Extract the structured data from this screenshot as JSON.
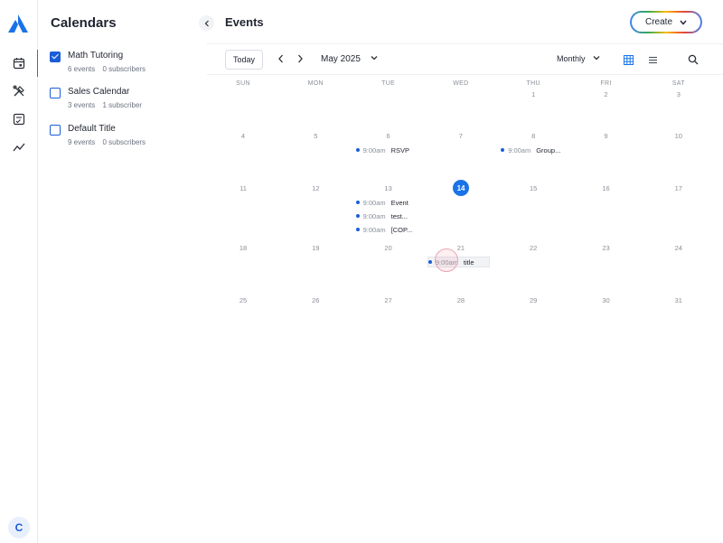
{
  "rail": {
    "nav_icons": [
      "calendar-icon",
      "tools-icon",
      "checklist-icon",
      "analytics-icon"
    ],
    "avatar_initial": "C"
  },
  "sidebar": {
    "title": "Calendars",
    "calendars": [
      {
        "name": "Math Tutoring",
        "events": "6 events",
        "subscribers": "0 subscribers",
        "checked": true
      },
      {
        "name": "Sales Calendar",
        "events": "3 events",
        "subscribers": "1 subscriber",
        "checked": false
      },
      {
        "name": "Default Title",
        "events": "9 events",
        "subscribers": "0 subscribers",
        "checked": false
      }
    ]
  },
  "header": {
    "title": "Events",
    "create_label": "Create"
  },
  "toolbar": {
    "today_label": "Today",
    "month_label": "May 2025",
    "view_label": "Monthly"
  },
  "calendar": {
    "weekdays": [
      "SUN",
      "MON",
      "TUE",
      "WED",
      "THU",
      "FRI",
      "SAT"
    ],
    "today": "14",
    "weeks": [
      [
        "",
        "",
        "",
        "",
        "1",
        "2",
        "3"
      ],
      [
        "4",
        "5",
        "6",
        "7",
        "8",
        "9",
        "10"
      ],
      [
        "11",
        "12",
        "13",
        "14",
        "15",
        "16",
        "17"
      ],
      [
        "18",
        "19",
        "20",
        "21",
        "22",
        "23",
        "24"
      ],
      [
        "25",
        "26",
        "27",
        "28",
        "29",
        "30",
        "31"
      ]
    ],
    "events": [
      {
        "week": 1,
        "day": 2,
        "slot": 0,
        "time": "9:00am",
        "title": "RSVP"
      },
      {
        "week": 1,
        "day": 4,
        "slot": 0,
        "time": "9:00am",
        "title": "Group..."
      },
      {
        "week": 2,
        "day": 2,
        "slot": 0,
        "time": "9:00am",
        "title": "Event"
      },
      {
        "week": 2,
        "day": 2,
        "slot": 1,
        "time": "9:00am",
        "title": "test..."
      },
      {
        "week": 2,
        "day": 2,
        "slot": 2,
        "time": "9:00am",
        "title": "[COP..."
      },
      {
        "week": 3,
        "day": 3,
        "slot": 0,
        "time": "9:00am",
        "title": "title",
        "hover": true
      }
    ]
  },
  "colors": {
    "accent": "#1a73e8",
    "event_dot": "#1a5ed8"
  }
}
